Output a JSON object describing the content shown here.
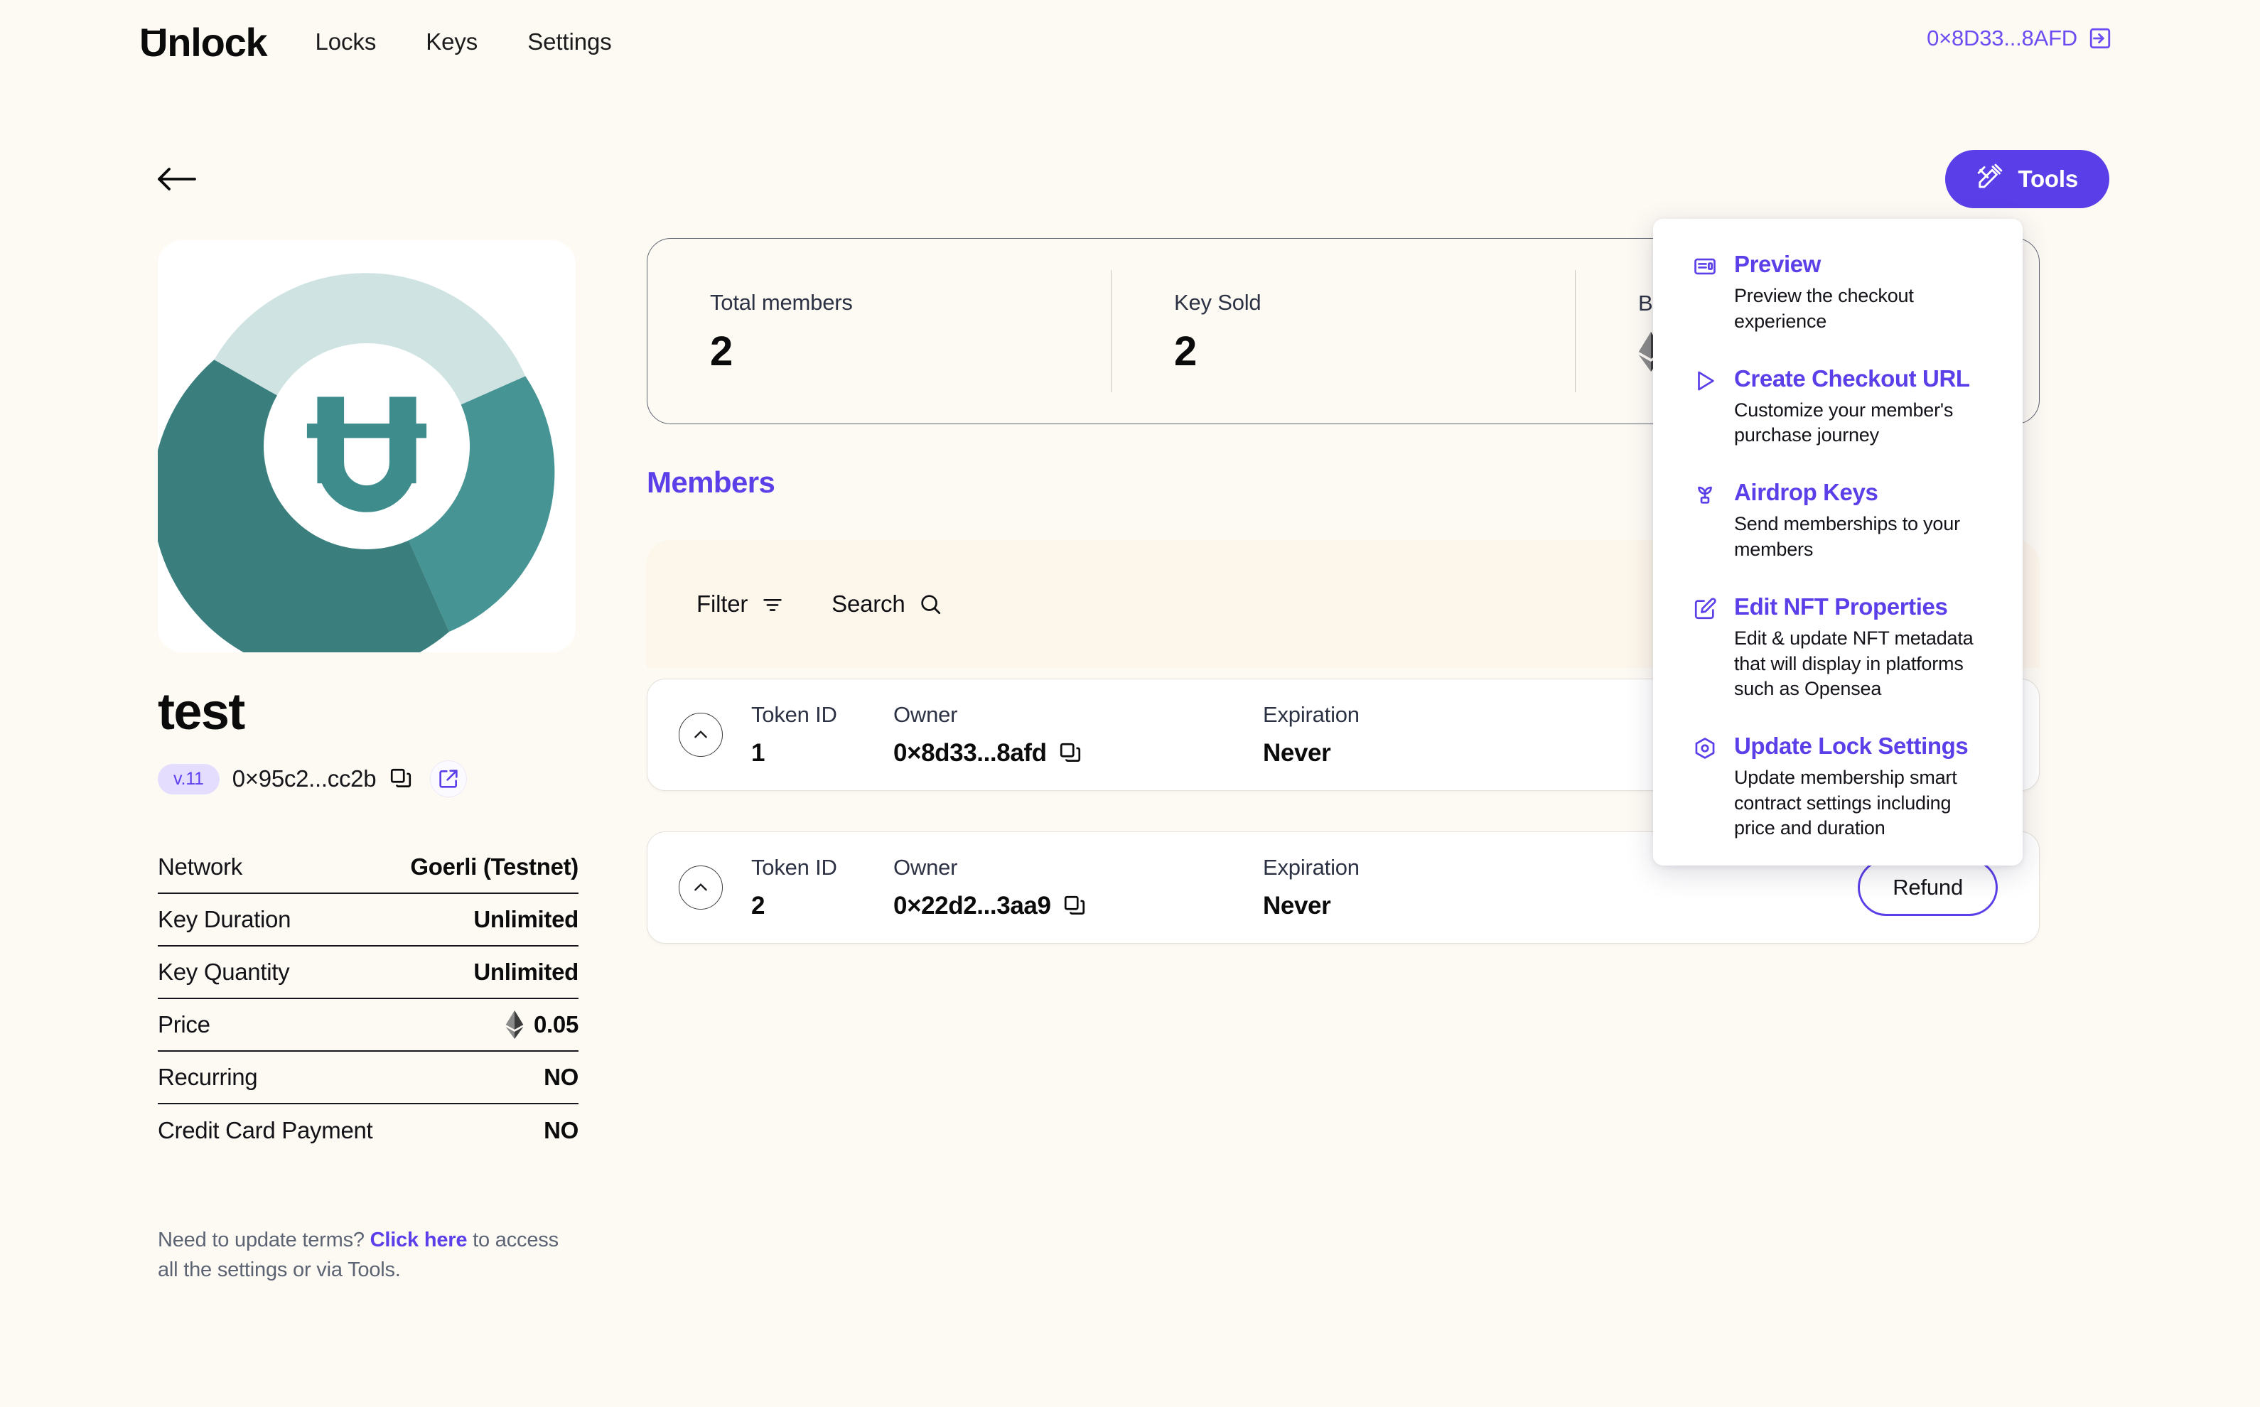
{
  "nav": {
    "brand": "Unlock",
    "links": [
      {
        "label": "Locks"
      },
      {
        "label": "Keys"
      },
      {
        "label": "Settings"
      }
    ],
    "wallet_address": "0×8D33...8AFD",
    "logout_icon": "logout-icon"
  },
  "header": {
    "back_icon": "arrow-left-icon",
    "tools_label": "Tools",
    "tools_icon": "tools-icon"
  },
  "lock": {
    "avatar_icon": "unlock-lock-avatar",
    "name": "test",
    "version_badge": "v.11",
    "address": "0×95c2...cc2b",
    "copy_icon": "copy-icon",
    "external_link_icon": "external-link-icon",
    "attributes": [
      {
        "label": "Network",
        "value": "Goerli (Testnet)",
        "eth": false
      },
      {
        "label": "Key Duration",
        "value": "Unlimited",
        "eth": false
      },
      {
        "label": "Key Quantity",
        "value": "Unlimited",
        "eth": false
      },
      {
        "label": "Price",
        "value": "0.05",
        "eth": true
      },
      {
        "label": "Recurring",
        "value": "NO",
        "eth": false
      },
      {
        "label": "Credit Card Payment",
        "value": "NO",
        "eth": false
      }
    ],
    "terms_prefix": "Need to update terms? ",
    "terms_link": "Click here",
    "terms_suffix": " to access all the settings or via Tools."
  },
  "stats": [
    {
      "label": "Total members",
      "value": "2",
      "eth": false
    },
    {
      "label": "Key Sold",
      "value": "2",
      "eth": false
    },
    {
      "label": "Bala",
      "value": "",
      "eth": true
    }
  ],
  "members": {
    "title": "Members",
    "filter_label": "Filter",
    "filter_icon": "filter-icon",
    "search_label": "Search",
    "search_icon": "search-icon",
    "columns": {
      "token_id": "Token ID",
      "owner": "Owner",
      "expiration": "Expiration"
    },
    "refund_label": "Refund",
    "rows": [
      {
        "token_id": "1",
        "owner": "0×8d33...8afd",
        "expiration": "Never",
        "toggle_icon": "chevron-up-icon",
        "copy_icon": "copy-icon"
      },
      {
        "token_id": "2",
        "owner": "0×22d2...3aa9",
        "expiration": "Never",
        "toggle_icon": "chevron-up-icon",
        "copy_icon": "copy-icon"
      }
    ]
  },
  "tools_menu": [
    {
      "title": "Preview",
      "desc": "Preview the checkout experience",
      "icon": "preview-card-icon"
    },
    {
      "title": "Create Checkout URL",
      "desc": "Customize your member's purchase journey",
      "icon": "play-triangle-icon"
    },
    {
      "title": "Airdrop Keys",
      "desc": "Send memberships to your members",
      "icon": "plant-icon"
    },
    {
      "title": "Edit NFT Properties",
      "desc": "Edit & update NFT metadata that will display in platforms such as Opensea",
      "icon": "edit-pencil-icon"
    },
    {
      "title": "Update Lock Settings",
      "desc": "Update membership smart contract settings including price and duration",
      "icon": "hexagon-gear-icon"
    }
  ],
  "colors": {
    "accent_purple": "#5B3FE8",
    "page_background": "#FDFAF4",
    "filter_background": "#FDF6EA",
    "badge_background": "#E4DDFE",
    "avatar_teal_dark": "#337C7C",
    "avatar_teal_mid": "#3E8C8C",
    "avatar_teal_light": "#CFE3E3"
  }
}
